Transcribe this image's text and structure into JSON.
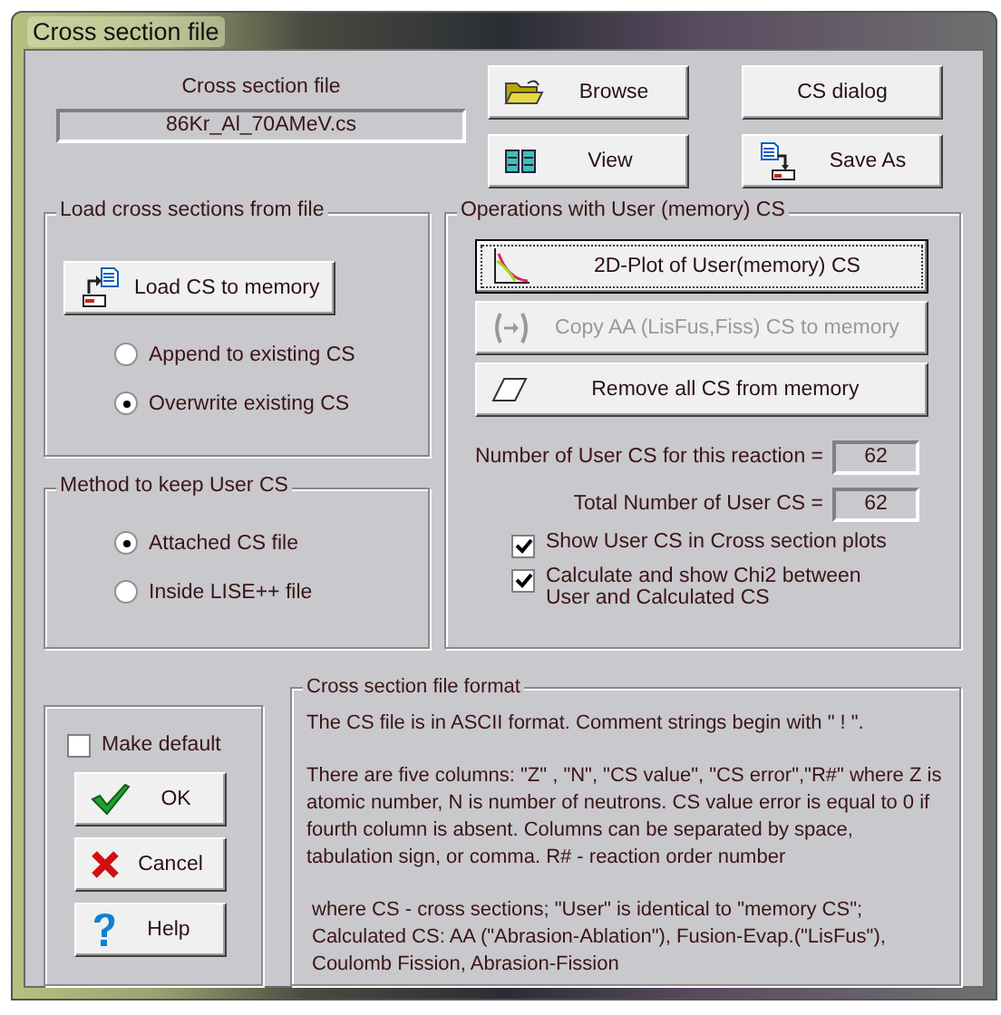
{
  "window": {
    "title": "Cross section file"
  },
  "file": {
    "label": "Cross section file",
    "value": "86Kr_Al_70AMeV.cs"
  },
  "top_buttons": [
    {
      "label": "Browse",
      "kind": "browse"
    },
    {
      "label": "CS dialog",
      "kind": "plain"
    },
    {
      "label": "View",
      "kind": "view"
    },
    {
      "label": "Save As",
      "kind": "save"
    }
  ],
  "load_group": {
    "title": "Load cross sections from file",
    "button": {
      "label": "Load CS to memory"
    },
    "options": [
      {
        "label": "Append to existing CS",
        "selected": false
      },
      {
        "label": "Overwrite  existing CS",
        "selected": true
      }
    ]
  },
  "keep_group": {
    "title": "Method to keep User CS",
    "options": [
      {
        "label": "Attached CS file",
        "selected": true
      },
      {
        "label": "Inside LISE++ file",
        "selected": false
      }
    ]
  },
  "operations": {
    "title": "Operations with User (memory) CS",
    "buttons": [
      {
        "label": "2D-Plot  of User(memory) CS",
        "kind": "plot",
        "disabled": false,
        "focused": true
      },
      {
        "label": "Copy AA (LisFus,Fiss) CS to memory",
        "kind": "copy",
        "disabled": true,
        "focused": false
      },
      {
        "label": "Remove all CS from memory",
        "kind": "eraser",
        "disabled": false,
        "focused": false
      }
    ],
    "counts": [
      {
        "label": "Number of User CS for this reaction =",
        "value": "62"
      },
      {
        "label": "Total Number of User CS =",
        "value": "62"
      }
    ],
    "checkboxes": [
      {
        "label": "Show User CS in Cross section plots",
        "checked": true
      },
      {
        "label": "Calculate and show Chi2 between User and Calculated CS",
        "checked": true
      }
    ]
  },
  "actions": {
    "make_default": {
      "label": "Make default",
      "checked": false
    },
    "buttons": [
      {
        "label": "OK",
        "kind": "ok"
      },
      {
        "label": "Cancel",
        "kind": "cancel"
      },
      {
        "label": "Help",
        "kind": "help"
      }
    ]
  },
  "format": {
    "title": "Cross section file format",
    "paragraphs": [
      "The CS file is in ASCII format. Comment strings begin with  \" ! \".",
      "There are five columns: \"Z\" , \"N\", \"CS value\", \"CS error\",\"R#\" where Z is atomic number, N is number of neutrons. CS value error is equal to 0 if fourth column is absent. Columns can be separated by space, tabulation sign, or comma. R# - reaction order number",
      "where CS - cross sections;  \"User\" is identical to \"memory CS\"; Calculated CS: AA (\"Abrasion-Ablation\"), Fusion-Evap.(\"LisFus\"), Coulomb Fission, Abrasion-Fission"
    ]
  }
}
